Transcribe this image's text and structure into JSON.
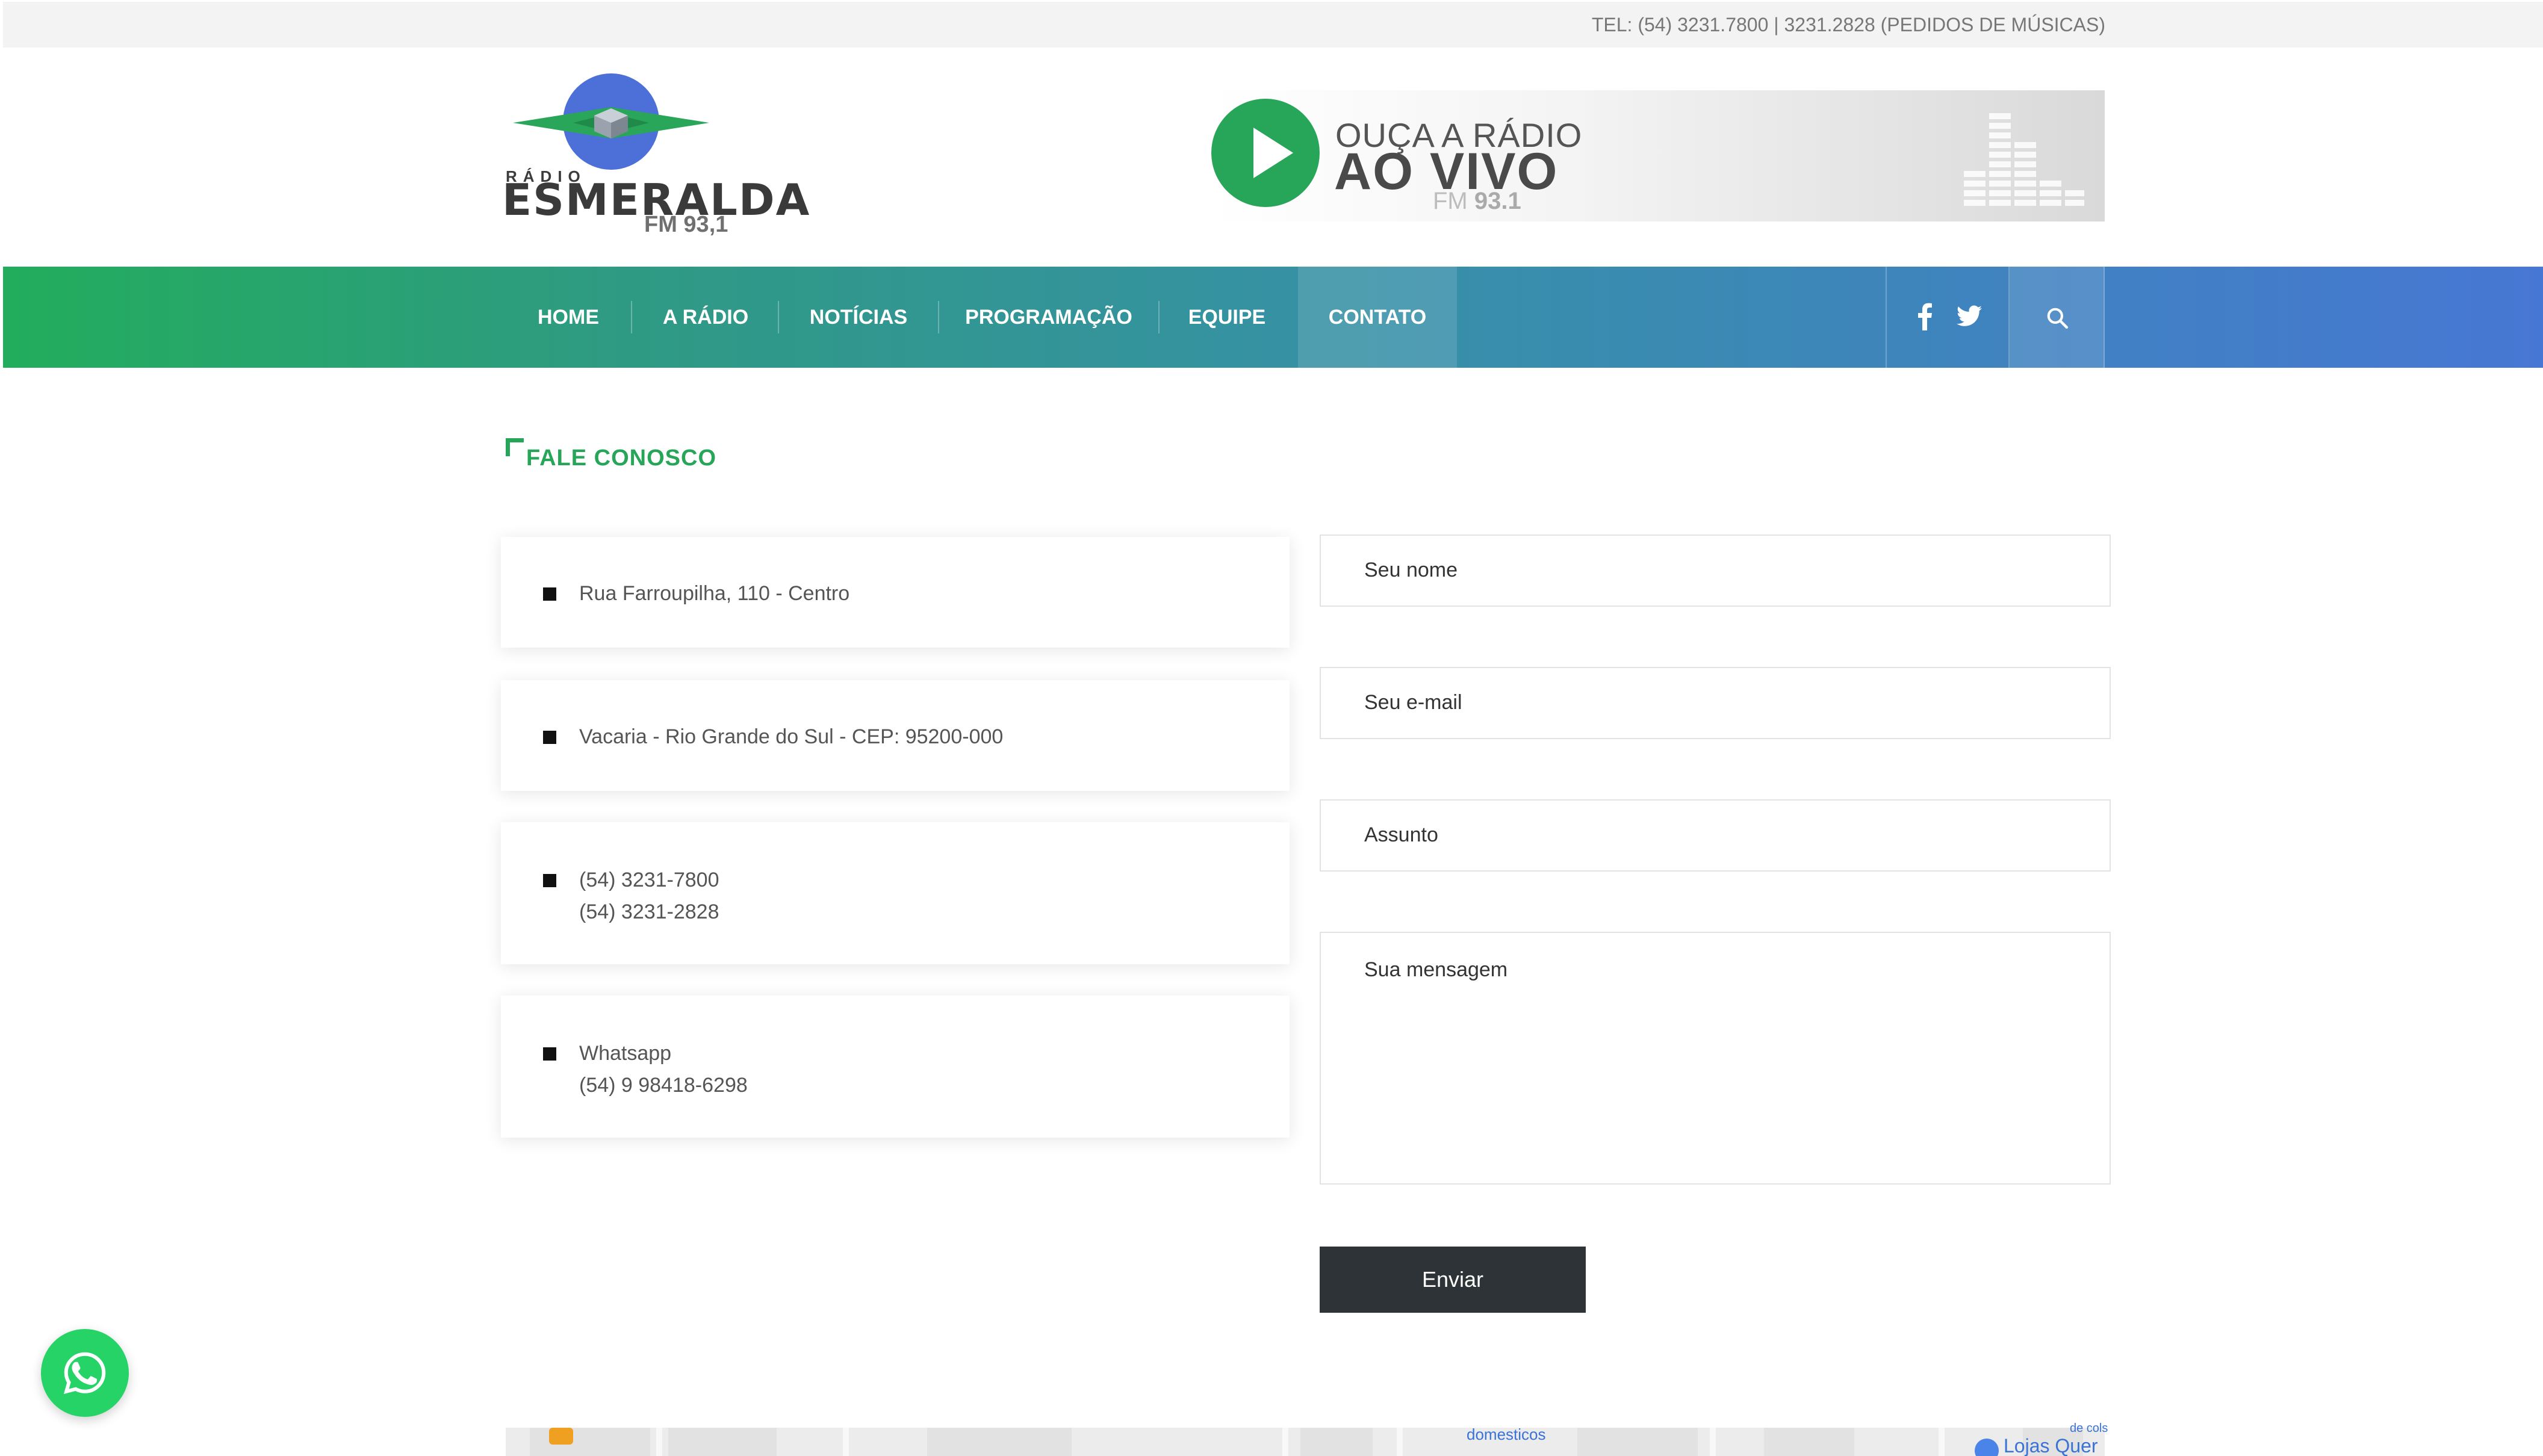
{
  "topbar": {
    "text": "TEL: (54) 3231.7800 | 3231.2828 (PEDIDOS DE MÚSICAS)"
  },
  "logo": {
    "top_text": "RÁDIO",
    "name": "ESMERALDA",
    "freq": "FM 93,1"
  },
  "live_banner": {
    "line1": "OUÇA A RÁDIO",
    "line2": "AO VIVO",
    "fm": "FM",
    "freq": "93.1"
  },
  "nav": {
    "items": [
      {
        "label": "HOME"
      },
      {
        "label": "A RÁDIO"
      },
      {
        "label": "NOTÍCIAS"
      },
      {
        "label": "PROGRAMAÇÃO"
      },
      {
        "label": "EQUIPE"
      },
      {
        "label": "CONTATO"
      }
    ],
    "active": "CONTATO"
  },
  "section": {
    "title": "FALE CONOSCO"
  },
  "contact_cards": [
    {
      "lines": [
        "Rua Farroupilha, 110 - Centro"
      ]
    },
    {
      "lines": [
        "Vacaria - Rio Grande do Sul - CEP: 95200-000"
      ]
    },
    {
      "lines": [
        "(54) 3231-7800",
        "(54) 3231-2828"
      ]
    },
    {
      "lines": [
        "Whatsapp",
        "(54) 9 98418-6298"
      ]
    }
  ],
  "form": {
    "name_placeholder": "Seu nome",
    "email_placeholder": "Seu e-mail",
    "subject_placeholder": "Assunto",
    "message_placeholder": "Sua mensagem",
    "submit_label": "Enviar"
  },
  "map": {
    "label1": "domesticos",
    "label2": "Lojas Quer",
    "label3": "de cols"
  },
  "colors": {
    "brand_green": "#27a558",
    "button_dark": "#2d3336",
    "whatsapp": "#25d366"
  }
}
